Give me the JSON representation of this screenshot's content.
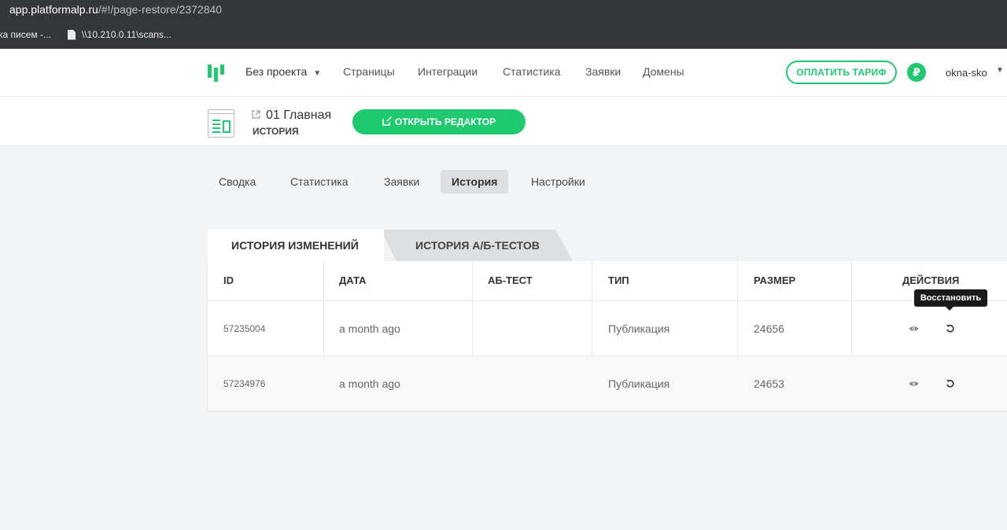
{
  "browser": {
    "url_host": "app.platformalp.ru",
    "url_path": "/#!/page-restore/2372840",
    "bookmarks": [
      {
        "label": "ка писем -..."
      },
      {
        "label": "\\\\10.210.0.11\\scans..."
      }
    ]
  },
  "header": {
    "project": "Без проекта",
    "nav": [
      "Страницы",
      "Интеграции",
      "Статистика",
      "Заявки",
      "Домены"
    ],
    "pay_button": "ОПЛАТИТЬ ТАРИФ",
    "currency_badge": "₽",
    "username": "okna-sko"
  },
  "page": {
    "title": "01 Главная",
    "subtitle": "ИСТОРИЯ",
    "editor_button": "ОТКРЫТЬ РЕДАКТОР"
  },
  "tabs": [
    {
      "label": "Сводка",
      "active": false
    },
    {
      "label": "Статистика",
      "active": false
    },
    {
      "label": "Заявки",
      "active": false
    },
    {
      "label": "История",
      "active": true
    },
    {
      "label": "Настройки",
      "active": false
    }
  ],
  "history_tabs": [
    "ИСТОРИЯ ИЗМЕНЕНИЙ",
    "ИСТОРИЯ А/Б-ТЕСТОВ"
  ],
  "table": {
    "columns": [
      "ID",
      "ДАТА",
      "АБ-ТЕСТ",
      "ТИП",
      "РАЗМЕР",
      "ДЕЙСТВИЯ"
    ],
    "rows": [
      {
        "id": "57235004",
        "date": "a month ago",
        "ab": "",
        "type": "Публикация",
        "size": "24656"
      },
      {
        "id": "57234976",
        "date": "a month ago",
        "ab": "",
        "type": "Публикация",
        "size": "24653"
      }
    ]
  },
  "tooltip": "Восстановить",
  "icons": {
    "view": "eye-icon",
    "restore": "restore-icon",
    "edit": "edit-icon",
    "external": "external-link-icon"
  },
  "colors": {
    "accent": "#1ec970",
    "browser_bg": "#35363a",
    "page_bg": "#f3f4f5"
  }
}
